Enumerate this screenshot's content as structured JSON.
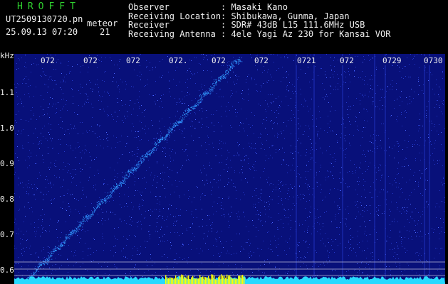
{
  "header": {
    "logo": "HROFFT",
    "filename": "UT2509130720.pn",
    "file_suffix": "meteor",
    "datetime": "25.09.13 07:20",
    "count": "21",
    "info": [
      {
        "label": "Observer",
        "value": ": Masaki Kano"
      },
      {
        "label": "Receiving Location",
        "value": ": Shibukawa, Gunma, Japan"
      },
      {
        "label": "Receiver",
        "value": ": SDR# 43dB L15 111.6MHz USB"
      },
      {
        "label": "Receiving Antenna",
        "value": ": 4ele Yagi Az 230 for Kansai VOR"
      }
    ]
  },
  "spectrogram": {
    "y_unit": "kHz",
    "y_ticks": [
      "1.1",
      "1.0",
      "0.9",
      "0.8",
      "0.7",
      "0.6"
    ],
    "x_ticks": [
      "072",
      "072",
      "072",
      "072.",
      "072",
      "072",
      "0721",
      "072",
      "0729",
      "0730"
    ],
    "background_color": "#08107a",
    "signal_color": "#3cc8ff",
    "noise_floor_color": "#27d9ff",
    "burst_color": "#ffff00"
  }
}
